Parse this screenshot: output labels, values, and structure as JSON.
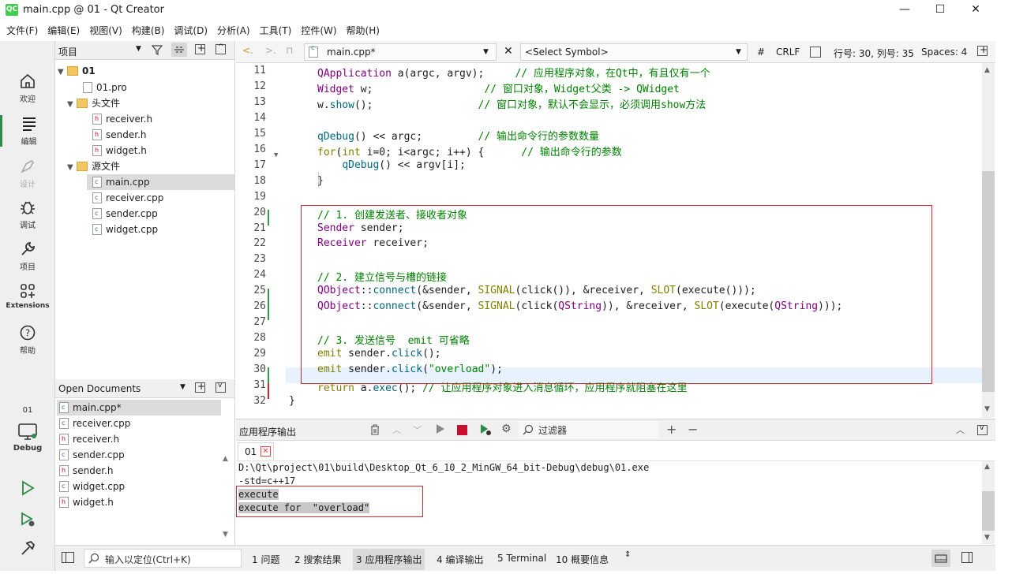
{
  "window": {
    "title": "main.cpp @ 01 - Qt Creator",
    "app_icon_text": "QC"
  },
  "menu": [
    "文件(F)",
    "编辑(E)",
    "视图(V)",
    "构建(B)",
    "调试(D)",
    "分析(A)",
    "工具(T)",
    "控件(W)",
    "帮助(H)"
  ],
  "modes": [
    {
      "label": "欢迎",
      "icon": "home-icon"
    },
    {
      "label": "编辑",
      "icon": "edit-icon"
    },
    {
      "label": "设计",
      "icon": "design-icon"
    },
    {
      "label": "调试",
      "icon": "bug-icon"
    },
    {
      "label": "项目",
      "icon": "wrench-icon"
    },
    {
      "label": "Extensions",
      "icon": "extensions-icon"
    },
    {
      "label": "帮助",
      "icon": "help-icon"
    }
  ],
  "kit": {
    "project": "01",
    "label": "Debug"
  },
  "project_pane": {
    "selector": "项目",
    "tree": [
      {
        "label": "01",
        "kind": "project"
      },
      {
        "label": "01.pro",
        "kind": "pro"
      },
      {
        "label": "头文件",
        "kind": "folder"
      },
      {
        "label": "receiver.h",
        "kind": "h"
      },
      {
        "label": "sender.h",
        "kind": "h"
      },
      {
        "label": "widget.h",
        "kind": "h"
      },
      {
        "label": "源文件",
        "kind": "folder"
      },
      {
        "label": "main.cpp",
        "kind": "c"
      },
      {
        "label": "receiver.cpp",
        "kind": "c"
      },
      {
        "label": "sender.cpp",
        "kind": "c"
      },
      {
        "label": "widget.cpp",
        "kind": "c"
      }
    ]
  },
  "open_documents": {
    "title": "Open Documents",
    "items": [
      "main.cpp*",
      "receiver.cpp",
      "receiver.h",
      "sender.cpp",
      "sender.h",
      "widget.cpp",
      "widget.h"
    ]
  },
  "editor_toolbar": {
    "file": "main.cpp*",
    "symbol": "<Select Symbol>",
    "hash": "#",
    "line_ending": "CRLF",
    "position": "行号: 30, 列号: 35",
    "indent": "Spaces: 4"
  },
  "code_lines": [
    {
      "n": "11",
      "html_key": 0
    },
    {
      "n": "12",
      "html_key": 1
    },
    {
      "n": "13",
      "html_key": 2
    },
    {
      "n": "14",
      "html_key": 3
    },
    {
      "n": "15",
      "html_key": 4
    },
    {
      "n": "16",
      "html_key": 5
    },
    {
      "n": "17",
      "html_key": 6
    },
    {
      "n": "18",
      "html_key": 7
    },
    {
      "n": "19",
      "html_key": 8
    },
    {
      "n": "20",
      "html_key": 9
    },
    {
      "n": "21",
      "html_key": 10
    },
    {
      "n": "22",
      "html_key": 11
    },
    {
      "n": "23",
      "html_key": 12
    },
    {
      "n": "24",
      "html_key": 13
    },
    {
      "n": "25",
      "html_key": 14
    },
    {
      "n": "26",
      "html_key": 15
    },
    {
      "n": "27",
      "html_key": 16
    },
    {
      "n": "28",
      "html_key": 17
    },
    {
      "n": "29",
      "html_key": 18
    },
    {
      "n": "30",
      "html_key": 19
    },
    {
      "n": "31",
      "html_key": 20
    },
    {
      "n": "32",
      "html_key": 21
    }
  ],
  "code_tokens": [
    [
      [
        "QApplication",
        "ty"
      ],
      [
        " a(argc, argv);     ",
        ""
      ],
      [
        "// 应用程序对象，在Qt中，有且仅有一个",
        "cm"
      ]
    ],
    [
      [
        "Widget",
        "ty"
      ],
      [
        " w;                  ",
        ""
      ],
      [
        "// 窗口对象，Widget父类 -> QWidget",
        "cm"
      ]
    ],
    [
      [
        "w.",
        ""
      ],
      [
        "show",
        "fn"
      ],
      [
        "();                 ",
        ""
      ],
      [
        "// 窗口对象，默认不会显示，必须调用show方法",
        "cm"
      ]
    ],
    [],
    [
      [
        "qDebug",
        "fn"
      ],
      [
        "() << argc;         ",
        ""
      ],
      [
        "// 输出命令行的参数数量",
        "cm"
      ]
    ],
    [
      [
        "for",
        "kw"
      ],
      [
        "(",
        ""
      ],
      [
        "int",
        "kw"
      ],
      [
        " i=0; i<argc; i++) {      ",
        ""
      ],
      [
        "// 输出命令行的参数",
        "cm"
      ]
    ],
    [
      [
        "    ",
        ""
      ],
      [
        "qDebug",
        "fn"
      ],
      [
        "() << argv[i];",
        ""
      ]
    ],
    [
      [
        "}",
        ""
      ]
    ],
    [],
    [
      [
        "// 1. 创建发送者、接收者对象",
        "cm"
      ]
    ],
    [
      [
        "Sender",
        "ty"
      ],
      [
        " sender;",
        ""
      ]
    ],
    [
      [
        "Receiver",
        "ty"
      ],
      [
        " receiver;",
        ""
      ]
    ],
    [],
    [
      [
        "// 2. 建立信号与槽的链接",
        "cm"
      ]
    ],
    [
      [
        "QObject",
        "ty"
      ],
      [
        "::",
        ""
      ],
      [
        "connect",
        "fn"
      ],
      [
        "(&sender, ",
        ""
      ],
      [
        "SIGNAL",
        "kw"
      ],
      [
        "(click()), &receiver, ",
        ""
      ],
      [
        "SLOT",
        "kw"
      ],
      [
        "(execute()));",
        ""
      ]
    ],
    [
      [
        "QObject",
        "ty"
      ],
      [
        "::",
        ""
      ],
      [
        "connect",
        "fn"
      ],
      [
        "(&sender, ",
        ""
      ],
      [
        "SIGNAL",
        "kw"
      ],
      [
        "(click(",
        ""
      ],
      [
        "QString",
        "ty"
      ],
      [
        ")), &receiver, ",
        ""
      ],
      [
        "SLOT",
        "kw"
      ],
      [
        "(execute(",
        ""
      ],
      [
        "QString",
        "ty"
      ],
      [
        ")));",
        ""
      ]
    ],
    [],
    [
      [
        "// 3. 发送信号  emit 可省略",
        "cm"
      ]
    ],
    [
      [
        "emit",
        "kw"
      ],
      [
        " sender.",
        ""
      ],
      [
        "click",
        "fn"
      ],
      [
        "();",
        ""
      ]
    ],
    [
      [
        "emit",
        "kw"
      ],
      [
        " sender.",
        ""
      ],
      [
        "click",
        "fn"
      ],
      [
        "(",
        ""
      ],
      [
        "\"overload\"",
        "st"
      ],
      [
        ");",
        ""
      ]
    ],
    [
      [
        "return",
        "kw"
      ],
      [
        " a.",
        ""
      ],
      [
        "exec",
        "fn"
      ],
      [
        "(); ",
        ""
      ],
      [
        "// 让应用程序对象进入消息循环，应用程序就阻塞在这里",
        "cm"
      ]
    ],
    [
      [
        "}",
        ""
      ]
    ]
  ],
  "output": {
    "title": "应用程序输出",
    "filter_placeholder": "过滤器",
    "tab": "01",
    "lines": [
      "D:\\Qt\\project\\01\\build\\Desktop_Qt_6_10_2_MinGW_64_bit-Debug\\debug\\01.exe",
      "-std=c++17",
      "execute",
      "execute for  \"overload\""
    ]
  },
  "statusbar": {
    "locator_placeholder": "输入以定位(Ctrl+K)",
    "tabs": [
      "1 问题",
      "2 搜索结果",
      "3 应用程序输出",
      "4 编译输出",
      "5 Terminal",
      "10 概要信息"
    ]
  },
  "colors": {
    "accent_green": "#41cd52",
    "annotation_red": "#d9232c",
    "current_line": "#e8f2fe"
  }
}
